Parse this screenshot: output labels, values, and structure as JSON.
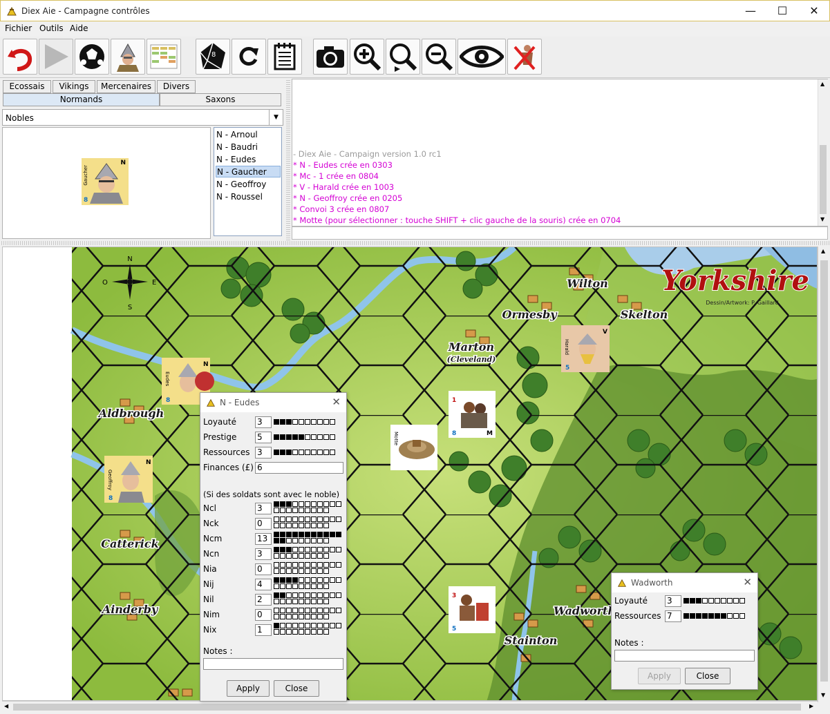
{
  "window": {
    "title": "Diex Aie - Campagne contrôles",
    "minimize": "—",
    "maximize": "☐",
    "close": "✕"
  },
  "menu": {
    "file": "Fichier",
    "tools": "Outils",
    "help": "Aide"
  },
  "toolbar": {
    "buttons": [
      "undo-icon",
      "play-icon",
      "soccer-ball-icon",
      "soldier-icon",
      "spreadsheet-icon",
      "d8-dice-icon",
      "redo-icon",
      "notepad-icon",
      "camera-icon",
      "zoom-in-icon",
      "zoom-reset-icon",
      "zoom-out-icon",
      "eye-icon",
      "remove-units-icon"
    ]
  },
  "tabs": {
    "row1": [
      "Ecossais",
      "Vikings",
      "Mercenaires",
      "Divers"
    ],
    "row2": [
      "Normands",
      "Saxons"
    ],
    "selected": "Normands"
  },
  "combo": {
    "value": "Nobles"
  },
  "preview": {
    "counter_name": "Gaucher",
    "counter_faction": "N",
    "counter_value": "8"
  },
  "nobles": {
    "items": [
      "N - Arnoul",
      "N - Baudri",
      "N - Eudes",
      "N - Gaucher",
      "N - Geoffroy",
      "N - Roussel"
    ],
    "selected": "N - Gaucher"
  },
  "log": {
    "lines": [
      {
        "text": "- Diex Aie - Campaign version 1.0 rc1",
        "color": "#9a9a9a"
      },
      {
        "text": "* N - Eudes crée en 0303",
        "color": "#d400d4"
      },
      {
        "text": "* Mc - 1 crée en 0804",
        "color": "#d400d4"
      },
      {
        "text": "* V - Harald crée en 1003",
        "color": "#d400d4"
      },
      {
        "text": "* N - Geoffroy crée en 0205",
        "color": "#d400d4"
      },
      {
        "text": "* Convoi 3 crée en 0807",
        "color": "#d400d4"
      },
      {
        "text": "* Motte (pour sélectionner : touche SHIFT + clic gauche de la souris) crée en 0704",
        "color": "#d400d4"
      }
    ]
  },
  "map": {
    "title": "Yorkshire",
    "credit": "Dessin/Artwork: P. Gaillard",
    "places": [
      "Wilton",
      "Ormesby",
      "Skelton",
      "Marton",
      "(Cleveland)",
      "Aldbrough",
      "Catterick",
      "Ainderby",
      "Stainton",
      "Wadworth"
    ],
    "compass": {
      "n": "N",
      "s": "S",
      "e": "E",
      "o": "O"
    },
    "counters": [
      {
        "name": "Eudes",
        "faction": "N",
        "value": "8"
      },
      {
        "name": "Geoffroy",
        "faction": "N",
        "value": "8"
      },
      {
        "name": "Harald",
        "faction": "V",
        "value": "5"
      },
      {
        "name": "Motte"
      },
      {
        "name": "",
        "faction": "M",
        "top": "1",
        "value": "8"
      },
      {
        "name": "",
        "top": "3",
        "value": "5"
      }
    ]
  },
  "dialog_noble": {
    "title": "N - Eudes",
    "close": "✕",
    "rows": [
      {
        "label": "Loyauté",
        "value": "3",
        "max": 10
      },
      {
        "label": "Prestige",
        "value": "5",
        "max": 10
      },
      {
        "label": "Ressources",
        "value": "3",
        "max": 10
      }
    ],
    "finances_label": "Finances (£)",
    "finances_value": "6",
    "soldiers_note": "(Si des soldats sont avec le noble)",
    "troops": [
      {
        "label": "Ncl",
        "value": "3"
      },
      {
        "label": "Nck",
        "value": "0"
      },
      {
        "label": "Ncm",
        "value": "13"
      },
      {
        "label": "Ncn",
        "value": "3"
      },
      {
        "label": "Nia",
        "value": "0"
      },
      {
        "label": "Nij",
        "value": "4"
      },
      {
        "label": "Nil",
        "value": "2"
      },
      {
        "label": "Nim",
        "value": "0"
      },
      {
        "label": "Nix",
        "value": "1"
      }
    ],
    "notes_label": "Notes :",
    "apply": "Apply",
    "close_btn": "Close"
  },
  "dialog_town": {
    "title": "Wadworth",
    "close": "✕",
    "rows": [
      {
        "label": "Loyauté",
        "value": "3",
        "max": 10
      },
      {
        "label": "Ressources",
        "value": "7",
        "max": 10
      }
    ],
    "notes_label": "Notes :",
    "apply": "Apply",
    "close_btn": "Close"
  },
  "colors": {
    "grass": "#8cbf3c",
    "forest": "#3f7f2a",
    "river": "#8fc4ea",
    "sea": "#a9cdea",
    "log_magenta": "#d400d4",
    "accent": "#dce8f5"
  }
}
